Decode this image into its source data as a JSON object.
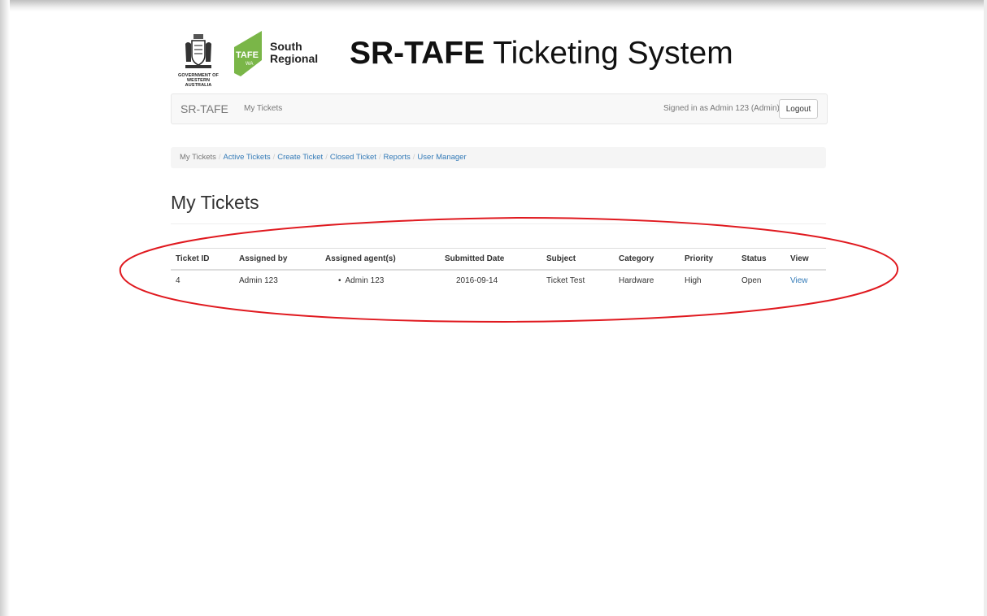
{
  "header": {
    "gov_logo_text_line1": "GOVERNMENT OF",
    "gov_logo_text_line2": "WESTERN AUSTRALIA",
    "tafe_leaf_text": "TAFE",
    "tafe_leaf_subtext": "WA",
    "tafe_south": "South",
    "tafe_regional": "Regional",
    "title_bold": "SR-TAFE",
    "title_rest": " Ticketing System",
    "tafe_green": "#7ab648"
  },
  "navbar": {
    "brand": "SR-TAFE",
    "link": "My Tickets",
    "signed_in": "Signed in as Admin 123 (Admin)",
    "logout": "Logout"
  },
  "breadcrumb": {
    "items": [
      {
        "label": "My Tickets",
        "active": true
      },
      {
        "label": "Active Tickets"
      },
      {
        "label": "Create Ticket"
      },
      {
        "label": "Closed Ticket"
      },
      {
        "label": "Reports"
      },
      {
        "label": "User Manager"
      }
    ],
    "separator": "/",
    "link_color": "#337ab7"
  },
  "page": {
    "title": "My Tickets"
  },
  "table": {
    "headers": [
      "Ticket ID",
      "Assigned by",
      "Assigned agent(s)",
      "Submitted Date",
      "Subject",
      "Category",
      "Priority",
      "Status",
      "View"
    ],
    "rows": [
      {
        "ticket_id": "4",
        "assigned_by": "Admin 123",
        "assigned_agent": "Admin 123",
        "submitted_date": "2016-09-14",
        "subject": "Ticket Test",
        "category": "Hardware",
        "priority": "High",
        "status": "Open",
        "view": "View"
      }
    ]
  },
  "annotation": {
    "shape": "ellipse",
    "color": "#e0191f"
  }
}
